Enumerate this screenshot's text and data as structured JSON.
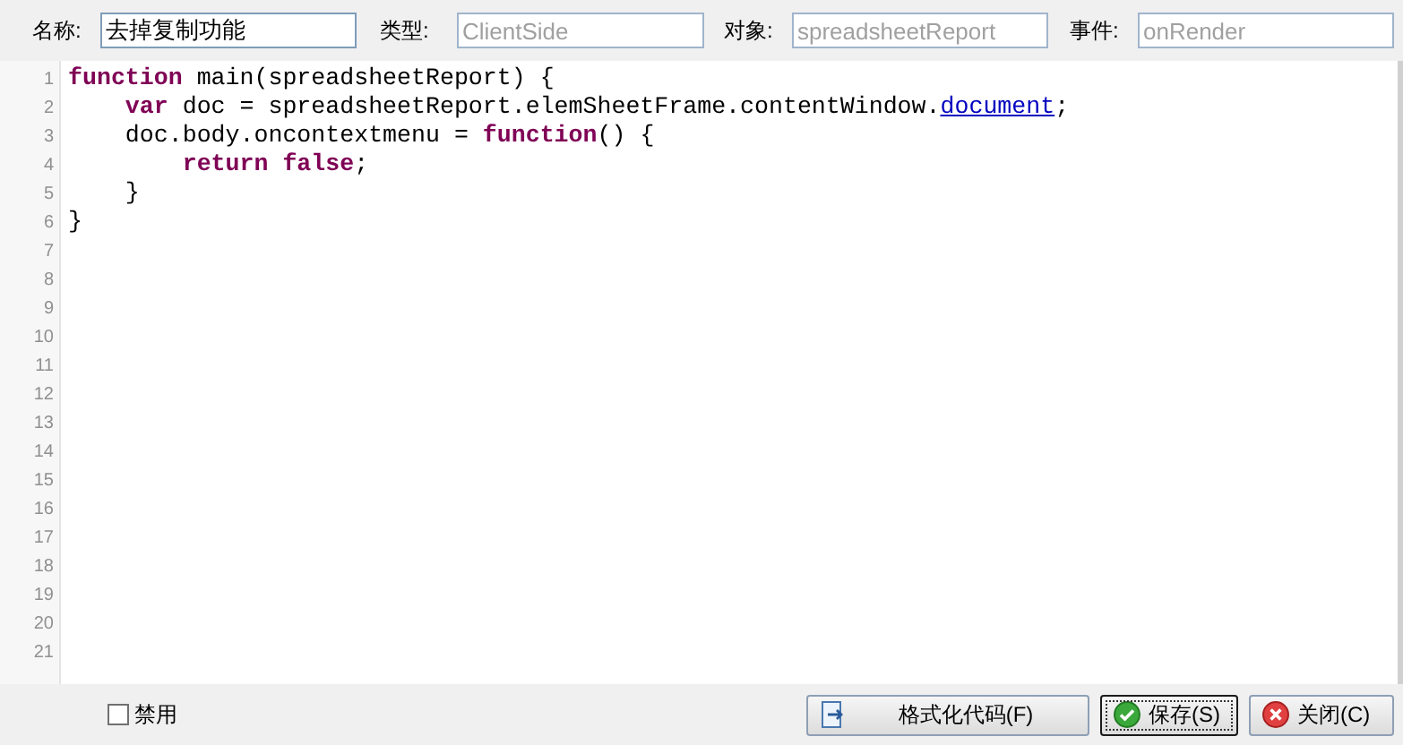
{
  "fields": [
    {
      "label": "名称:",
      "value": "去掉复制功能",
      "disabled": false
    },
    {
      "label": "类型:",
      "value": "ClientSide",
      "disabled": true
    },
    {
      "label": "对象:",
      "value": "spreadsheetReport",
      "disabled": true
    },
    {
      "label": "事件:",
      "value": "onRender",
      "disabled": true
    }
  ],
  "editor": {
    "line_numbers": [
      "1",
      "2",
      "3",
      "4",
      "5",
      "6",
      "7",
      "8",
      "9",
      "10",
      "11",
      "12",
      "13",
      "14",
      "15",
      "16",
      "17",
      "18",
      "19",
      "20",
      "21"
    ],
    "lines": [
      [
        {
          "kind": "keyword",
          "text": "function"
        },
        {
          "kind": "plain",
          "text": " main(spreadsheetReport) {"
        }
      ],
      [
        {
          "kind": "keyword",
          "text": "    var"
        },
        {
          "kind": "plain",
          "text": " doc = spreadsheetReport.elemSheetFrame.contentWindow."
        },
        {
          "kind": "link",
          "text": "document"
        },
        {
          "kind": "plain",
          "text": ";"
        }
      ],
      [
        {
          "kind": "plain",
          "text": "    doc.body.oncontextmenu = "
        },
        {
          "kind": "keyword",
          "text": "function"
        },
        {
          "kind": "plain",
          "text": "() {"
        }
      ],
      [
        {
          "kind": "keyword",
          "text": "        return"
        },
        {
          "kind": "keyword",
          "text": " false"
        },
        {
          "kind": "plain",
          "text": ";"
        }
      ],
      [
        {
          "kind": "plain",
          "text": "    }"
        }
      ],
      [
        {
          "kind": "plain",
          "text": "}"
        }
      ]
    ]
  },
  "disable_checkbox": {
    "label": "禁用",
    "checked": false
  },
  "buttons": [
    {
      "label": "格式化代码(F)",
      "kind": "format",
      "focused": false
    },
    {
      "label": "保存(S)",
      "kind": "save",
      "focused": true
    },
    {
      "label": "关闭(C)",
      "kind": "close",
      "focused": false
    }
  ]
}
